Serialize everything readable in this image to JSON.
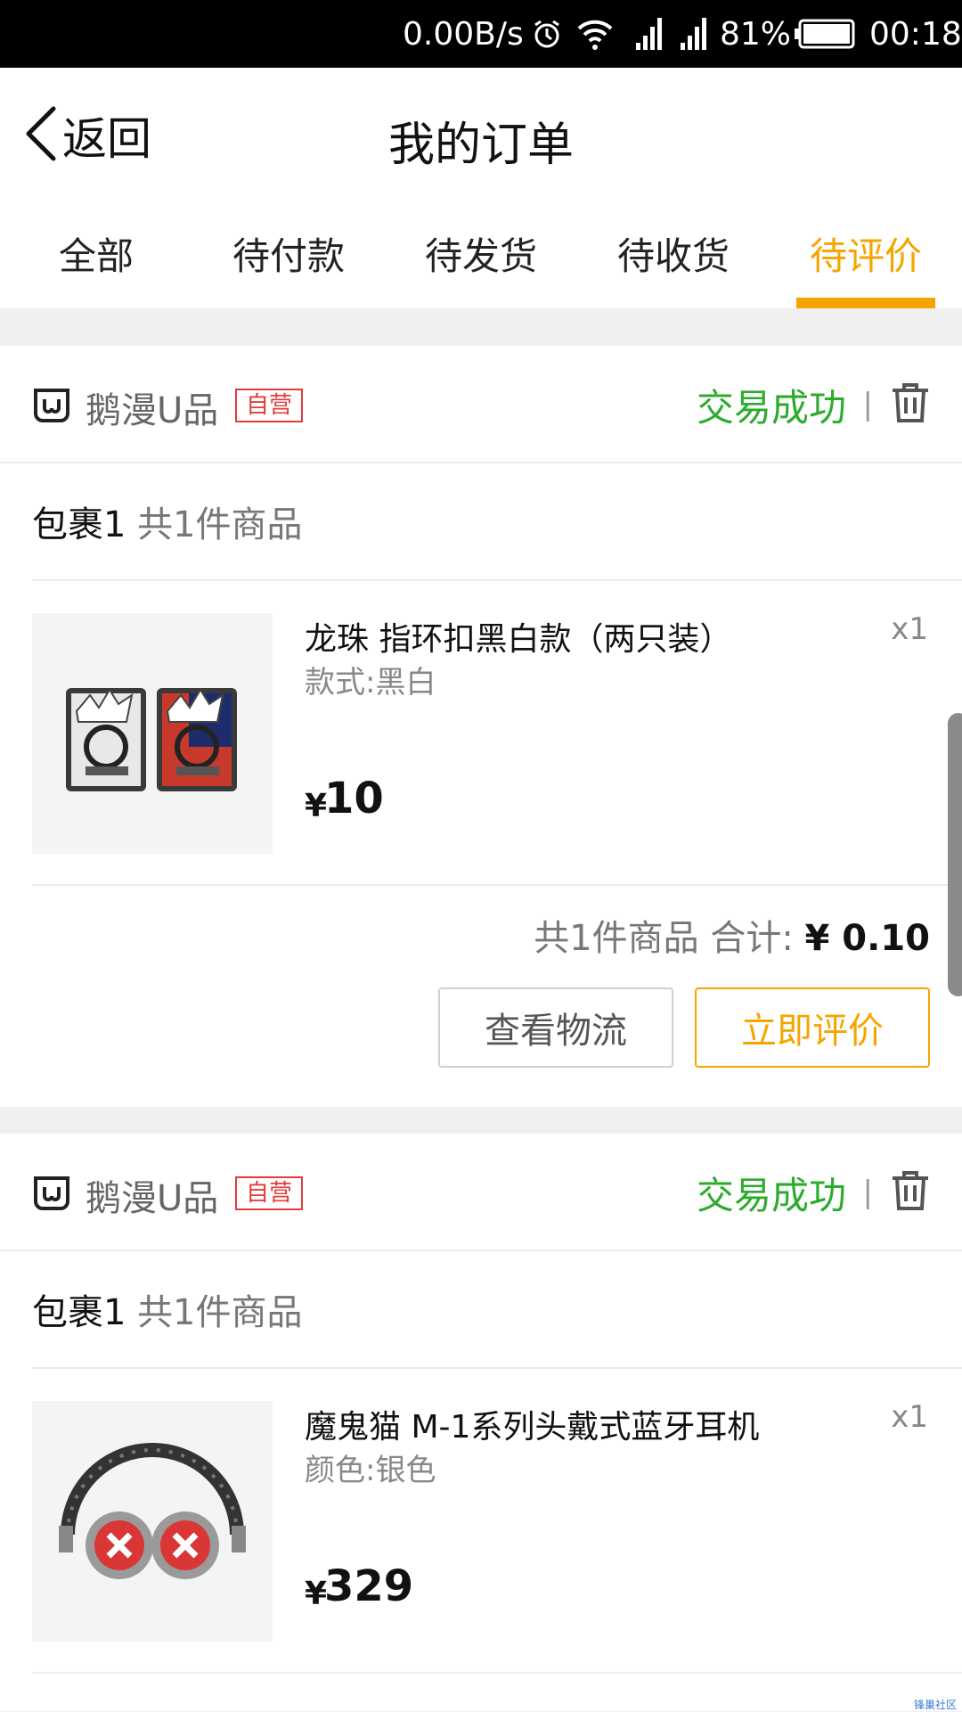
{
  "status_bar": {
    "network_speed": "0.00B/s",
    "battery": "81%",
    "time": "00:18"
  },
  "header": {
    "back_label": "返回",
    "title": "我的订单"
  },
  "tabs": [
    {
      "label": "全部",
      "active": false
    },
    {
      "label": "待付款",
      "active": false
    },
    {
      "label": "待发货",
      "active": false
    },
    {
      "label": "待收货",
      "active": false
    },
    {
      "label": "待评价",
      "active": true
    }
  ],
  "orders": [
    {
      "shop_name": "鹅漫U品",
      "shop_badge": "自营",
      "status": "交易成功",
      "divider": "|",
      "package_title": "包裹1",
      "package_count": "共1件商品",
      "item": {
        "name": "龙珠 指环扣黑白款（两只装）",
        "spec": "款式:黑白",
        "qty": "x1",
        "price_symbol": "¥",
        "price": "10"
      },
      "total_label": "共1件商品 合计:",
      "total_amount": "¥ 0.10",
      "btn_logistics": "查看物流",
      "btn_review": "立即评价"
    },
    {
      "shop_name": "鹅漫U品",
      "shop_badge": "自营",
      "status": "交易成功",
      "divider": "|",
      "package_title": "包裹1",
      "package_count": "共1件商品",
      "item": {
        "name": "魔鬼猫 M-1系列头戴式蓝牙耳机",
        "spec": "颜色:银色",
        "qty": "x1",
        "price_symbol": "¥",
        "price": "329"
      }
    }
  ],
  "watermark": "锋巢社区",
  "colors": {
    "accent": "#f5a500",
    "success": "#2dab2d",
    "badge_red": "#e23b3b"
  }
}
